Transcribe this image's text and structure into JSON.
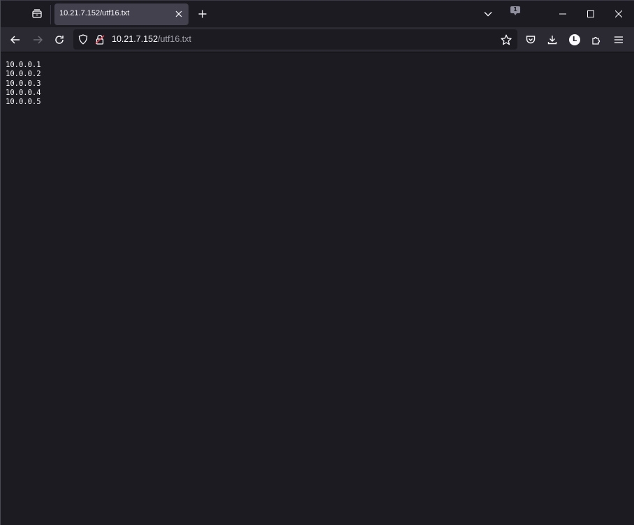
{
  "browser": {
    "tab": {
      "title": "10.21.7.152/utf16.txt"
    },
    "badge_count": "1",
    "url": {
      "host": "10.21.7.152",
      "path": "/utf16.txt"
    },
    "profile_initial": "L",
    "icons": [
      "tab-list-icon",
      "close-icon",
      "plus-icon",
      "chevron-down-icon",
      "minimize-icon",
      "maximize-icon",
      "back-icon",
      "forward-icon",
      "reload-icon",
      "shield-icon",
      "lock-icon",
      "star-icon",
      "pocket-icon",
      "download-icon",
      "extensions-icon",
      "menu-icon"
    ]
  },
  "content": {
    "lines": [
      "10.0.0.1",
      "10.0.0.2",
      "10.0.0.3",
      "10.0.0.4",
      "10.0.0.5"
    ]
  }
}
